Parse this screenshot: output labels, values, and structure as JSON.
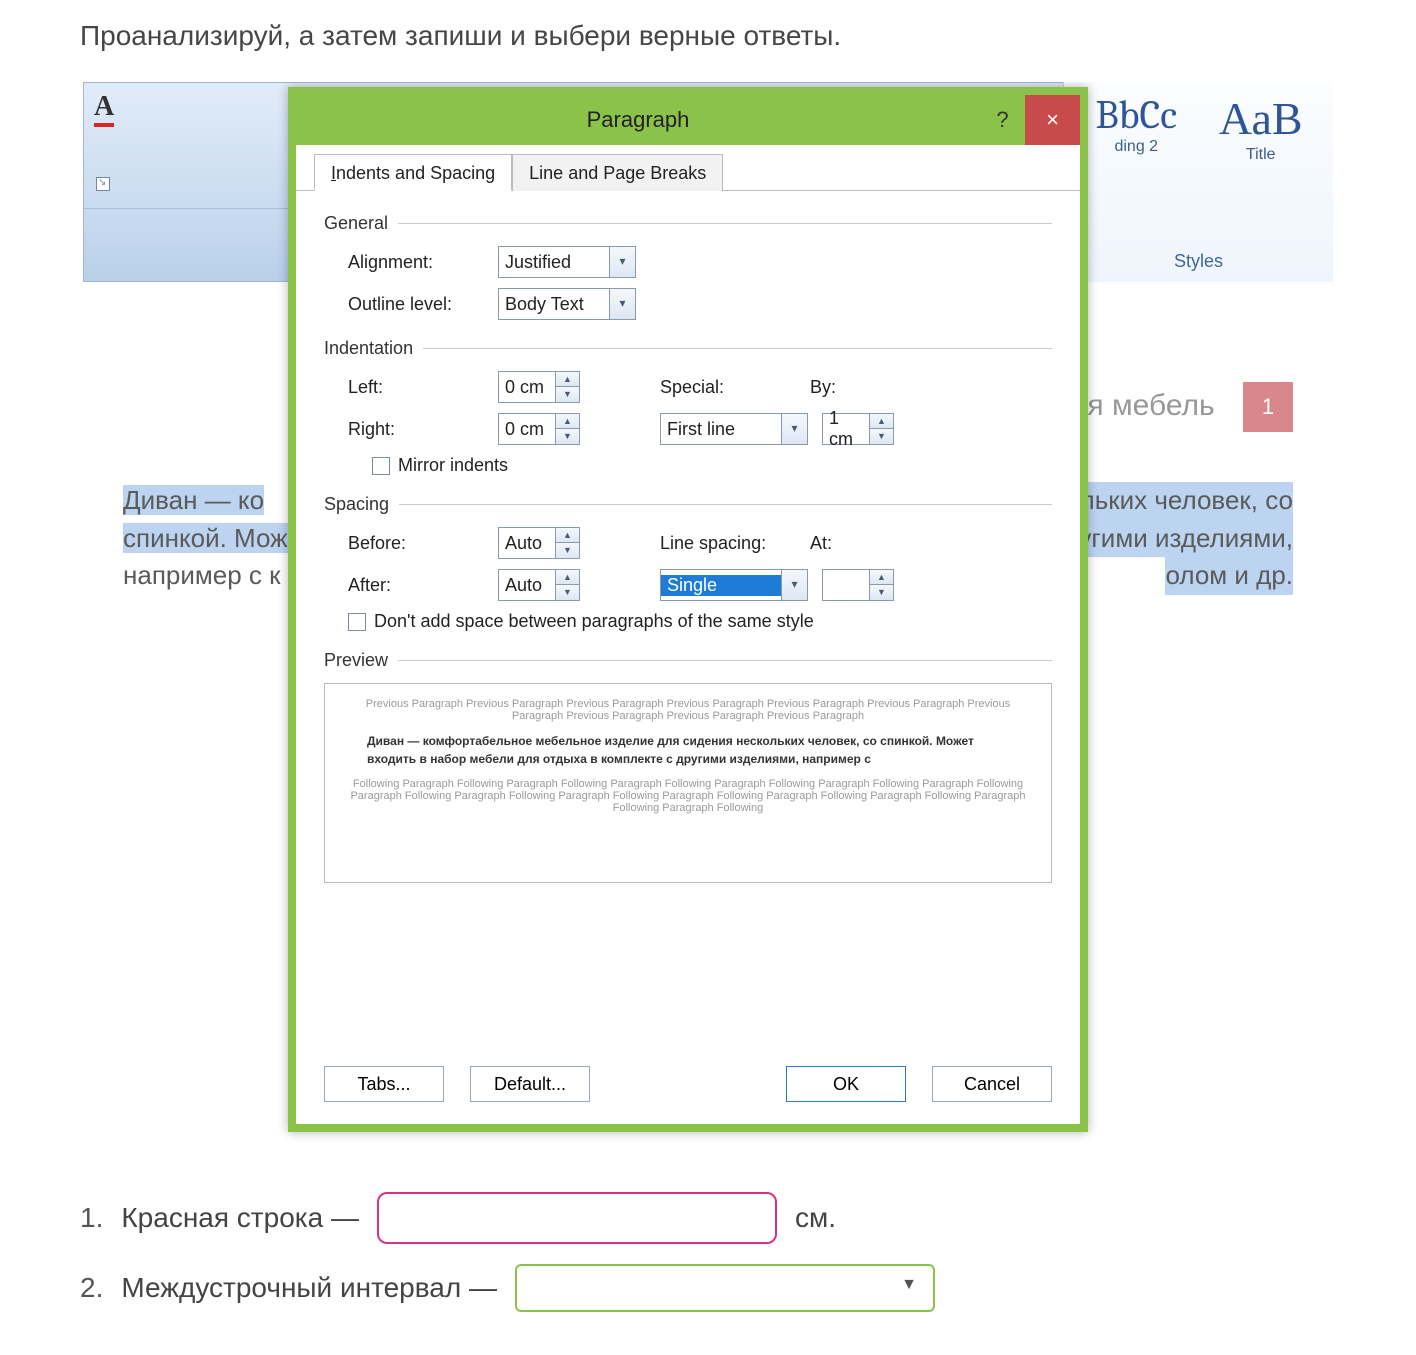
{
  "task": {
    "title": "Проанализируй, а затем запиши и выбери верные ответы."
  },
  "ribbon": {
    "style1_sample": "BbCc",
    "style1_name": "ding 2",
    "style2_sample": "АаВ",
    "style2_name": "Title",
    "group_label": "Styles",
    "cut_right_char": "A"
  },
  "document": {
    "heading_fragment": "ая мебель",
    "page_number": "1",
    "line1_left": "Диван — ко",
    "line1_right": "льких человек, со",
    "line2_left": "спинкой. Мож",
    "line2_right": "ругими изделиями,",
    "line3_left": "например с к",
    "line3_right": "олом и др."
  },
  "dialog": {
    "title": "Paragraph",
    "help": "?",
    "close": "×",
    "tabs": {
      "indents": "Indents and Spacing",
      "breaks": "Line and Page Breaks"
    },
    "general": {
      "legend": "General",
      "alignment_label": "Alignment:",
      "alignment_value": "Justified",
      "outline_label": "Outline level:",
      "outline_value": "Body Text"
    },
    "indentation": {
      "legend": "Indentation",
      "left_label": "Left:",
      "left_value": "0 cm",
      "right_label": "Right:",
      "right_value": "0 cm",
      "special_label": "Special:",
      "special_value": "First line",
      "by_label": "By:",
      "by_value": "1 cm",
      "mirror_label": "Mirror indents"
    },
    "spacing": {
      "legend": "Spacing",
      "before_label": "Before:",
      "before_value": "Auto",
      "after_label": "After:",
      "after_value": "Auto",
      "line_label": "Line spacing:",
      "line_value": "Single",
      "at_label": "At:",
      "at_value": "",
      "nospace_label": "Don't add space between paragraphs of the same style"
    },
    "preview": {
      "legend": "Preview",
      "prev_text": "Previous Paragraph Previous Paragraph Previous Paragraph Previous Paragraph Previous Paragraph Previous Paragraph Previous Paragraph Previous Paragraph Previous Paragraph Previous Paragraph",
      "sample_text": "Диван — комфортабельное мебельное изделие для сидения нескольких человек, со спинкой. Может входить в набор мебели для отдыха в комплекте с другими изделиями, например с",
      "next_text": "Following Paragraph Following Paragraph Following Paragraph Following Paragraph Following Paragraph Following Paragraph Following Paragraph Following Paragraph Following Paragraph Following Paragraph Following Paragraph Following Paragraph Following Paragraph Following Paragraph Following"
    },
    "buttons": {
      "tabs": "Tabs...",
      "default": "Default...",
      "ok": "OK",
      "cancel": "Cancel"
    }
  },
  "questions": {
    "q1_num": "1.",
    "q1_text": "Красная строка —",
    "q1_unit": "см.",
    "q2_num": "2.",
    "q2_text": "Междустрочный интервал —"
  }
}
